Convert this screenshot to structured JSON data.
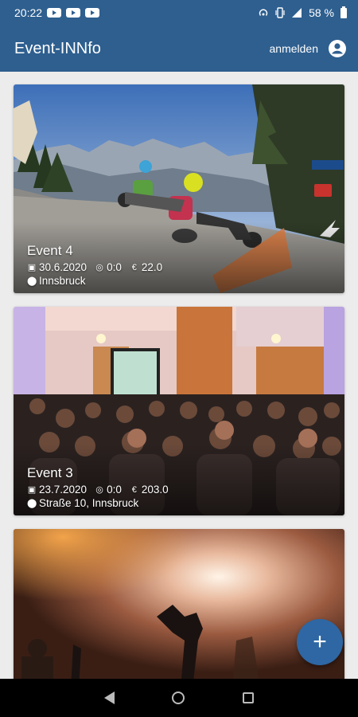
{
  "status_bar": {
    "time": "20:22",
    "battery": "58 %",
    "icons": [
      "youtube-icon",
      "youtube-icon",
      "youtube-icon",
      "hotspot-icon",
      "vibrate-icon",
      "signal-icon",
      "battery-icon"
    ]
  },
  "app_bar": {
    "title": "Event-INNfo",
    "login_label": "anmelden",
    "account_icon": "account-circle-icon"
  },
  "events": [
    {
      "title": "Event 4",
      "date": "30.6.2020",
      "attendees": "0:0",
      "price": "22.0",
      "location": "Innsbruck"
    },
    {
      "title": "Event 3",
      "date": "23.7.2020",
      "attendees": "0:0",
      "price": "203.0",
      "location": "Straße 10, Innsbruck"
    },
    {
      "title": "",
      "date": "",
      "attendees": "",
      "price": "",
      "location": ""
    }
  ],
  "fab": {
    "label": "+",
    "icon": "add-icon"
  },
  "colors": {
    "primary": "#2e5f8f",
    "fab": "#2e67a3"
  },
  "nav_bar": {
    "icons": [
      "back-icon",
      "home-icon",
      "recents-icon"
    ]
  }
}
